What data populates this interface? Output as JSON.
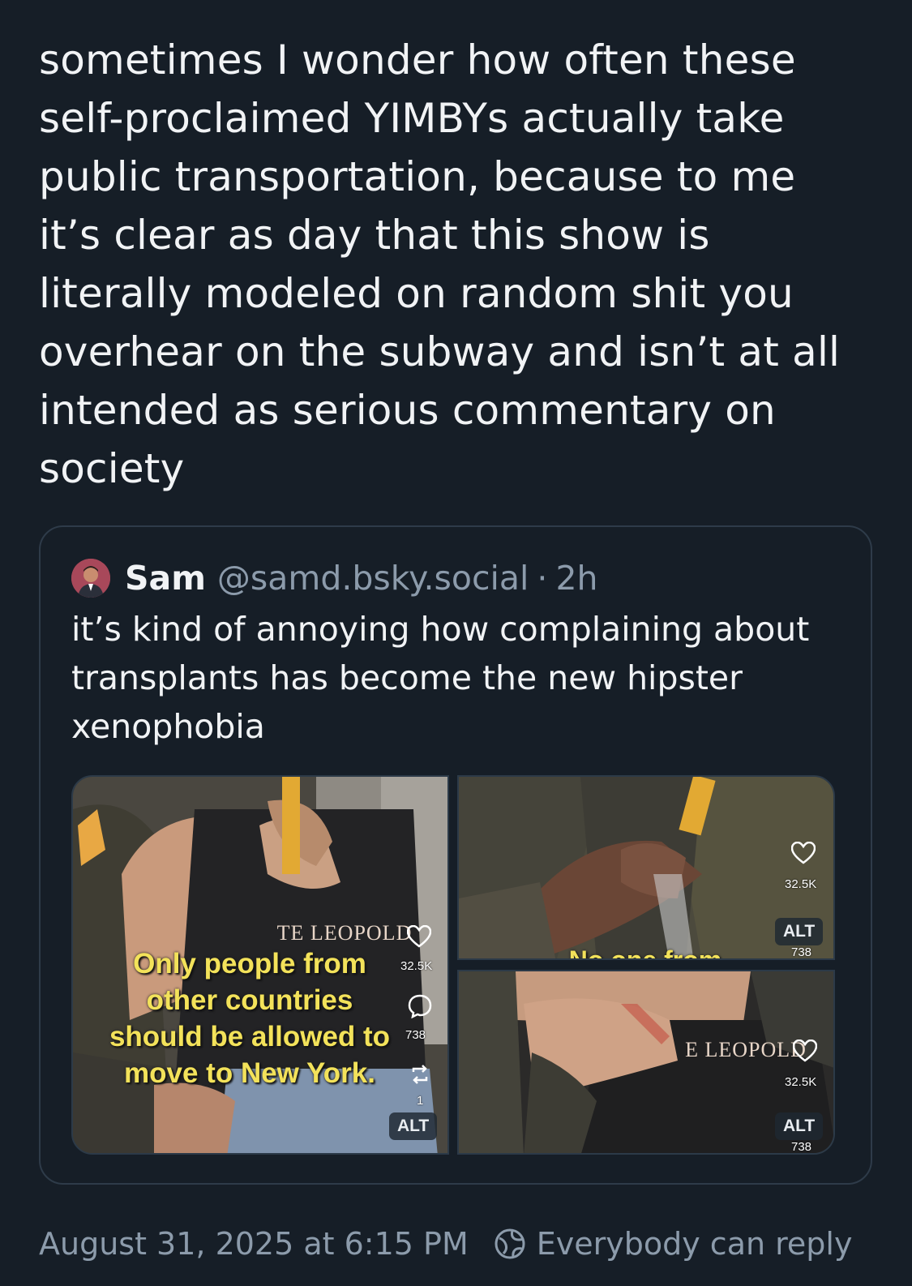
{
  "post": {
    "text": "sometimes I wonder how often these\nself-proclaimed YIMBYs actually take\npublic transportation, because to me\nit’s clear as day that this show is\nliterally modeled on random shit you\noverhear on the subway and isn’t at all\nintended as serious commentary on\nsociety"
  },
  "quote": {
    "name": "Sam",
    "handle": "@samd.bsky.social",
    "separator": "·",
    "time": "2h",
    "text": "it’s kind of annoying how complaining about transplants has become the new hipster xenophobia",
    "images": [
      {
        "caption": "Only people from\nother countries\nshould be allowed to\nmove to New York.",
        "shirt_logo": "TE LEOPOLD",
        "likes": "32.5K",
        "comments": "738",
        "reposts": "1",
        "alt_label": "ALT"
      },
      {
        "caption": "No one from",
        "likes": "32.5K",
        "comments": "738",
        "alt_label": "ALT"
      },
      {
        "shirt_logo": "E LEOPOLD",
        "likes": "32.5K",
        "comments": "738",
        "alt_label": "ALT"
      }
    ]
  },
  "footer": {
    "timestamp": "August 31, 2025 at 6:15 PM",
    "reply_setting": "Everybody can reply"
  },
  "colors": {
    "background": "#161e27",
    "text": "#f1f3f5",
    "muted": "#8c9bab",
    "border": "#2e3b49",
    "caption_yellow": "#f3e25a"
  }
}
